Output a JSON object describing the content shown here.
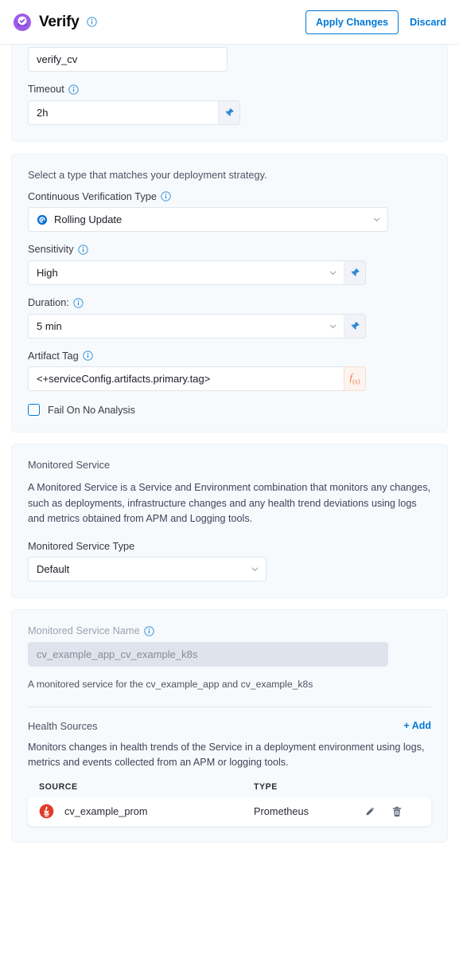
{
  "header": {
    "title": "Verify",
    "title_info_icon": "info-icon",
    "app_icon": "verify-icon",
    "apply_label": "Apply Changes",
    "discard_label": "Discard",
    "accent_blue": "#0278d5"
  },
  "step_card": {
    "name_value": "verify_cv",
    "timeout_label": "Timeout",
    "timeout_value": "2h",
    "pin_icon": "pin-icon"
  },
  "cv_card": {
    "intro": "Select a type that matches your deployment strategy.",
    "cv_type_label": "Continuous Verification Type",
    "cv_type_value": "Rolling Update",
    "cv_type_icon": "rolling-update-icon",
    "sensitivity_label": "Sensitivity",
    "sensitivity_value": "High",
    "duration_label": "Duration:",
    "duration_value": "5 min",
    "artifact_label": "Artifact Tag",
    "artifact_value": "<+serviceConfig.artifacts.primary.tag>",
    "fx_label": "f",
    "fx_sub": "(x)",
    "fail_checkbox_label": "Fail On No Analysis",
    "fail_checkbox_checked": false
  },
  "monitored_service_card": {
    "heading": "Monitored Service",
    "description": "A Monitored Service is a Service and Environment combination that monitors any changes, such as deployments, infrastructure changes and any health trend deviations using logs and metrics obtained from APM and Logging tools.",
    "type_label": "Monitored Service Type",
    "type_value": "Default"
  },
  "ms_name_card": {
    "name_label": "Monitored Service Name",
    "name_value": "cv_example_app_cv_example_k8s",
    "name_helper": "A monitored service for the cv_example_app and cv_example_k8s",
    "health_sources_title": "Health Sources",
    "add_label": "+ Add",
    "health_sources_description": "Monitors changes in health trends of the Service in a deployment environment using logs, metrics and events collected from an APM or logging tools.",
    "table": {
      "columns": [
        "SOURCE",
        "TYPE"
      ],
      "rows": [
        {
          "source": "cv_example_prom",
          "source_icon": "prometheus-icon",
          "type": "Prometheus",
          "edit_icon": "pencil-icon",
          "delete_icon": "trash-icon"
        }
      ]
    }
  }
}
